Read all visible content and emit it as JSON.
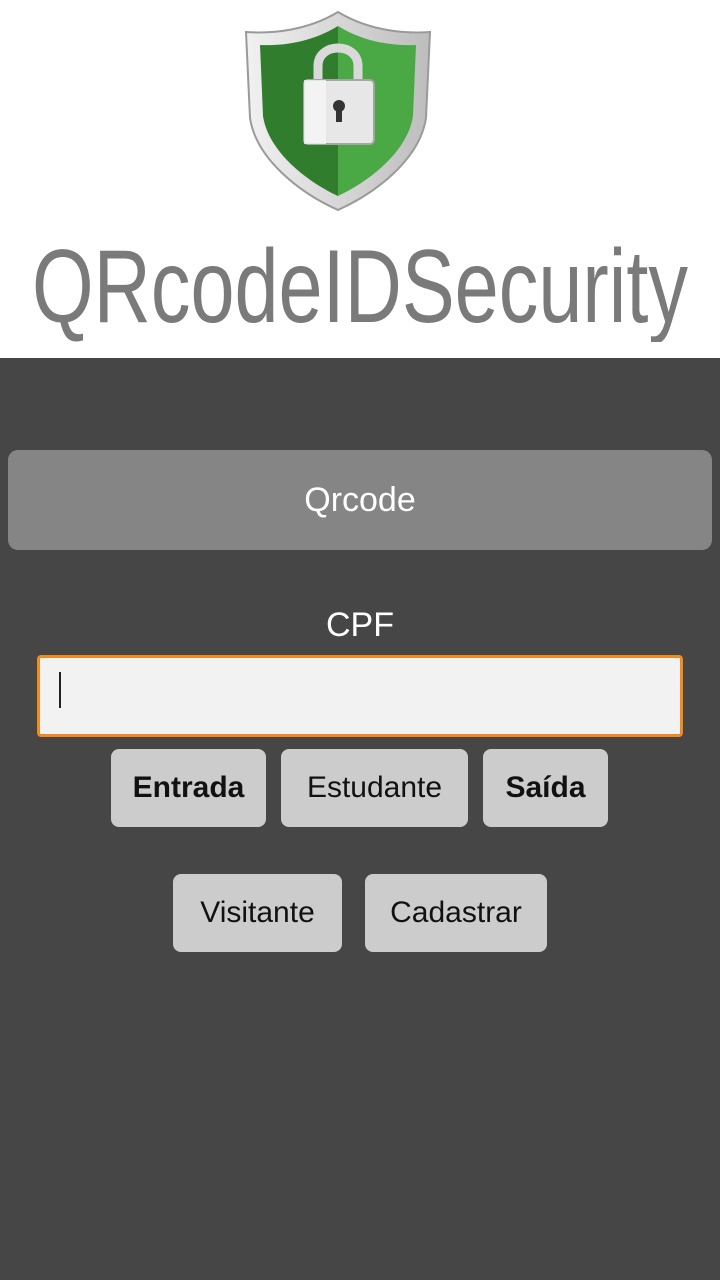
{
  "app": {
    "logo_text": "QRcodeIDSecurity"
  },
  "colors": {
    "background": "#464646",
    "header_bg": "#ffffff",
    "primary_button": "#858585",
    "secondary_button": "#cccccc",
    "input_border": "#f08a1c",
    "shield_green": "#3f9b3a"
  },
  "icons": {
    "logo": "shield-lock-icon"
  },
  "main": {
    "qrcode_label": "Qrcode",
    "cpf_label": "CPF",
    "cpf_value": "",
    "buttons": {
      "entrada": "Entrada",
      "estudante": "Estudante",
      "saida": "Saída",
      "visitante": "Visitante",
      "cadastrar": "Cadastrar"
    }
  }
}
